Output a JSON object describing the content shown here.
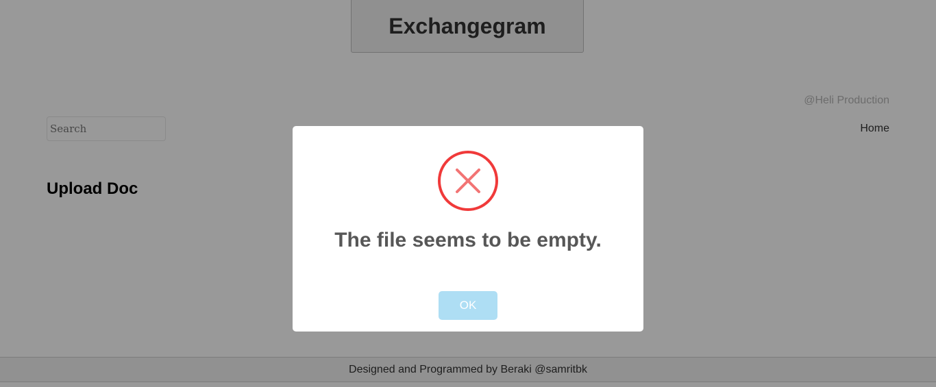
{
  "app": {
    "title": "Exchangegram"
  },
  "header": {
    "credit": "@Heli Production"
  },
  "search": {
    "placeholder": "Search"
  },
  "nav": {
    "home_label": "Home"
  },
  "main": {
    "heading": "Upload Doc"
  },
  "footer": {
    "text": "Designed and Programmed by Beraki @samritbk"
  },
  "modal": {
    "icon": "error-x-icon",
    "message": "The file seems to be empty.",
    "ok_label": "OK",
    "colors": {
      "error": "#f27474",
      "ok_button": "#aedef4"
    }
  }
}
